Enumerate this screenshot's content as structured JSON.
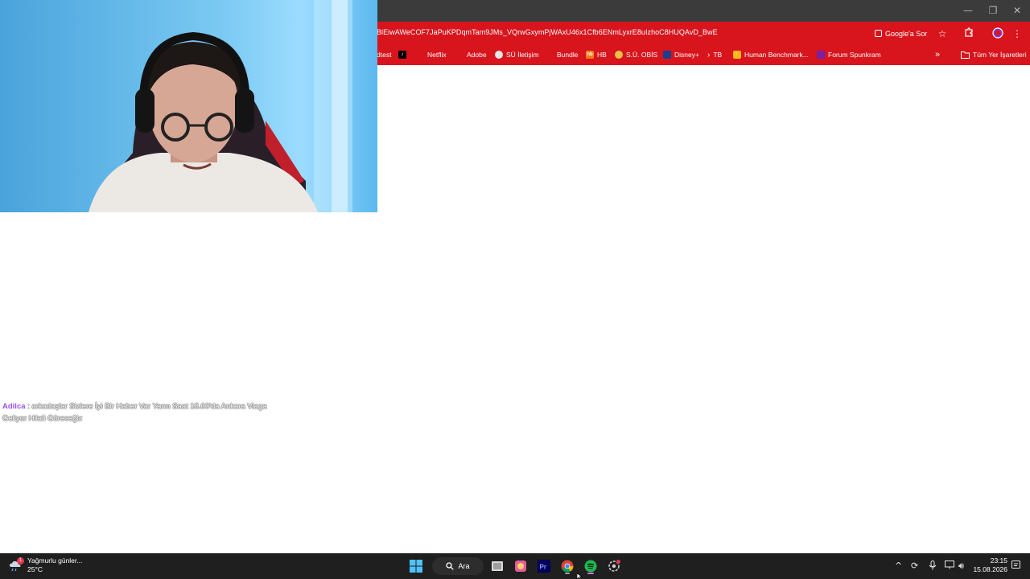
{
  "window_controls": {
    "minimize": "—",
    "maximize": "❐",
    "close": "✕"
  },
  "toolbar": {
    "url": "BlEiwAWeCOF7JaPuKPDqmTam9JMs_VQrwGxymPjWAxU46x1Cfb6ENmLyxrE8uIzhoC8HUQAvD_BwE",
    "google_sor": "Google'a Sor",
    "star_icon": "star-icon",
    "extensions_icon": "puzzle-icon",
    "profile_icon": "profile-icon",
    "menu_icon": "menu-icon",
    "accent_color": "#d8141c"
  },
  "bookmarks": {
    "items": [
      {
        "label": "dtest"
      },
      {
        "label": ""
      },
      {
        "label": "Netflix"
      },
      {
        "label": "Adobe"
      },
      {
        "label": "SÜ İletişim"
      },
      {
        "label": "Bundle"
      },
      {
        "label": "HB"
      },
      {
        "label": "S.Ü. OBİS"
      },
      {
        "label": "Disney+"
      },
      {
        "label": "TB"
      },
      {
        "label": "Human Benchmark..."
      },
      {
        "label": "Forum Spunkram"
      }
    ],
    "overflow": "»",
    "all_bookmarks": "Tüm Yer İşaretleri"
  },
  "chat": {
    "user": "Adilca",
    "message": " : arkadaşlar Sizlere İyi Bir Haber Var Yarın Saat 18.00'da Ankara Viaga Geliyor Hilali Göreceğiz"
  },
  "taskbar": {
    "weather_text": "Yağmurlu günler...",
    "weather_temp": "25°C",
    "weather_badge": "1",
    "search_label": "Ara",
    "time": "23:15",
    "date": "15.08.2026",
    "apps": [
      "windows-start-icon",
      "search-icon",
      "file-explorer-icon",
      "photos-icon",
      "premiere-icon",
      "chrome-icon",
      "spotify-icon",
      "settings-icon"
    ]
  }
}
